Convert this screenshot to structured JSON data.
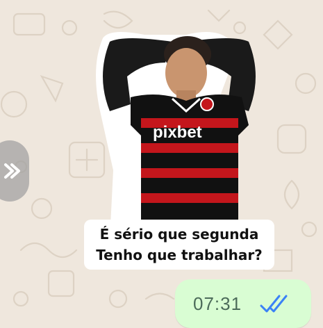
{
  "sticker": {
    "caption_line1": "É sério que segunda",
    "caption_line2": "Tenho que trabalhar?",
    "jersey_sponsor": "pixbet",
    "jersey_colors": [
      "#c4161c",
      "#111111"
    ]
  },
  "message": {
    "time": "07:31",
    "status_icon": "double-check-read-icon",
    "status_color": "#3b82f6",
    "bubble_color": "#d9fdd3"
  },
  "chat": {
    "background_color": "#efe7dd",
    "forward_icon": "forward-arrow-icon"
  }
}
